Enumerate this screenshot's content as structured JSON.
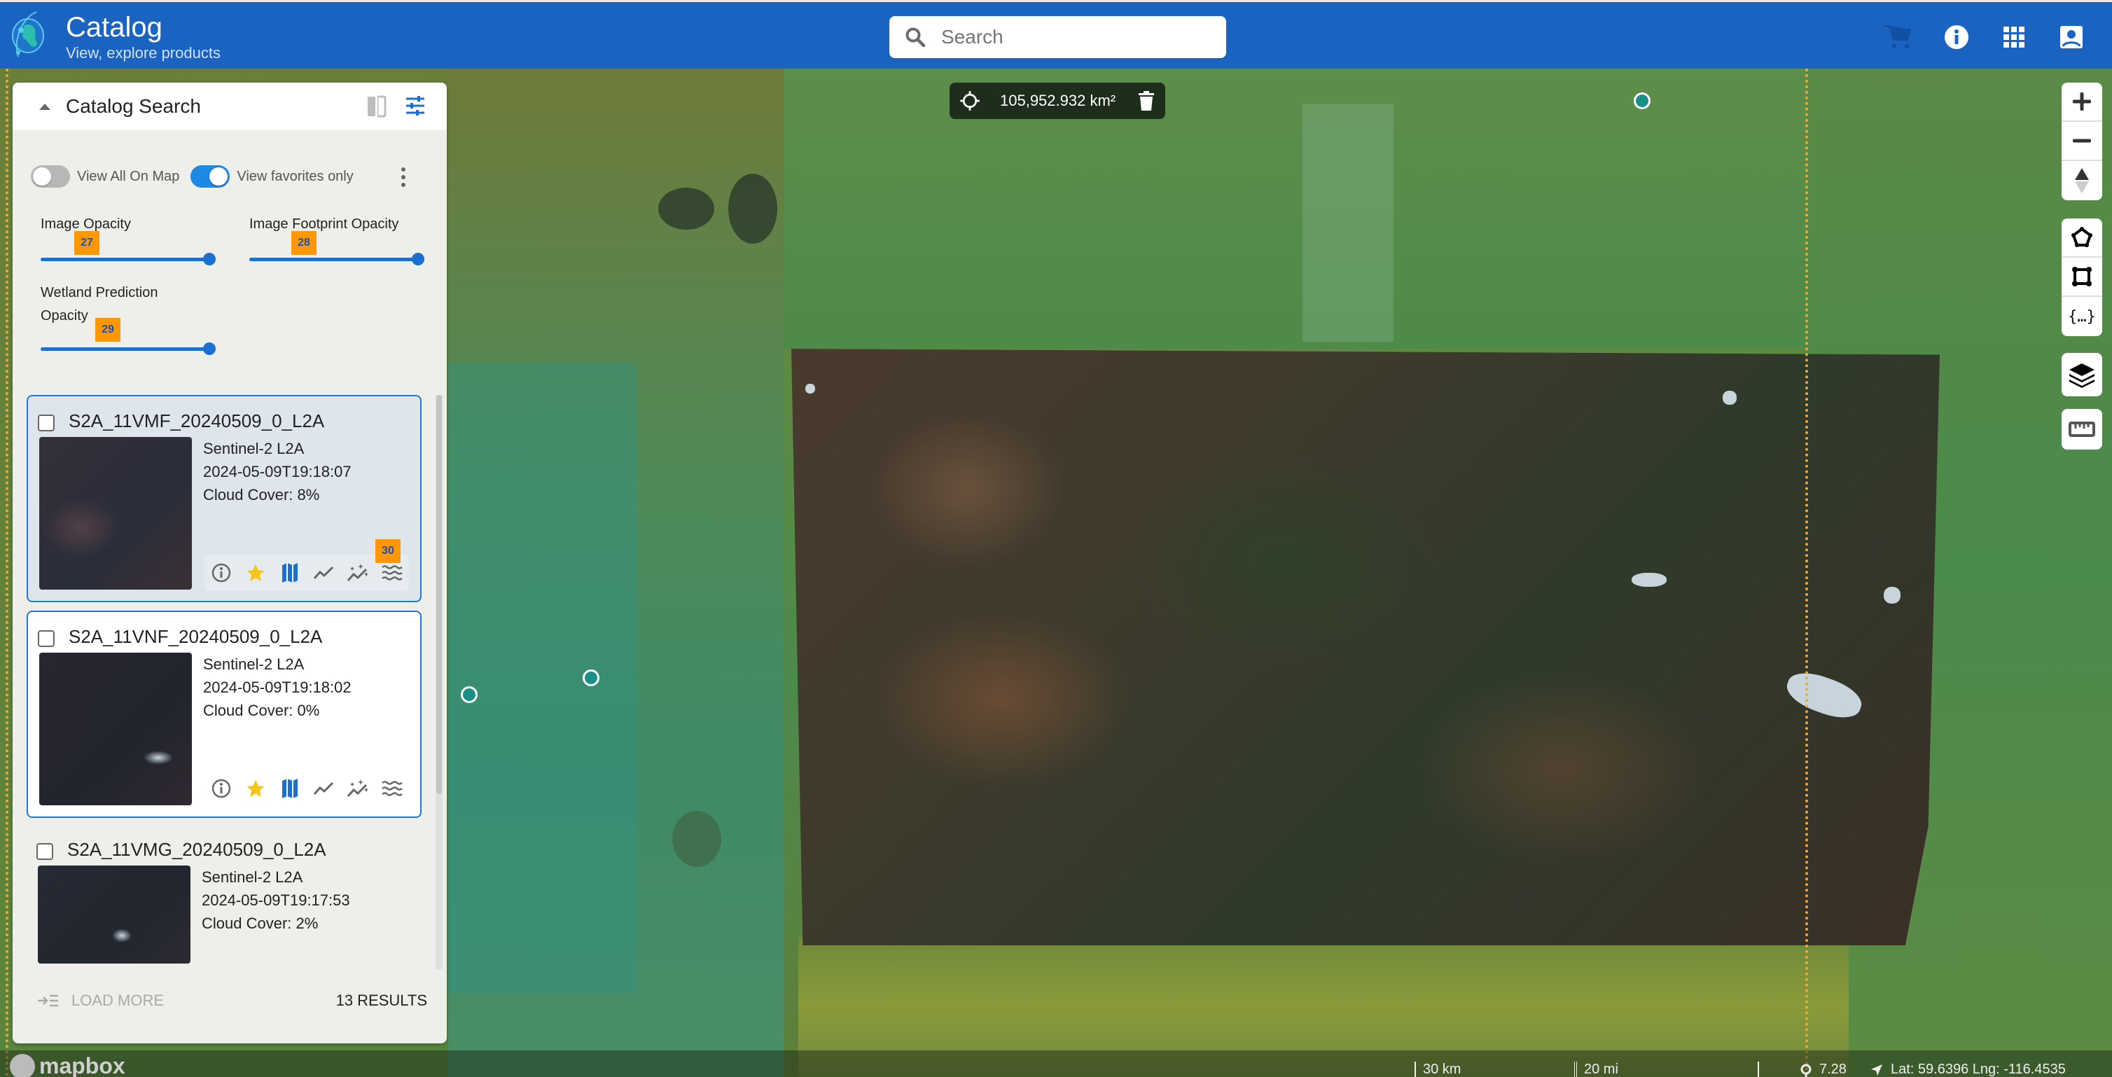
{
  "header": {
    "title": "Catalog",
    "subtitle": "View, explore products",
    "search_placeholder": "Search",
    "icons": [
      "cart-icon",
      "info-icon",
      "apps-grid-icon",
      "account-icon"
    ]
  },
  "map": {
    "area_measure": "105,952.932 km²",
    "controls": {
      "navigation": [
        "zoom-in",
        "zoom-out",
        "compass"
      ],
      "draw": [
        "polygon",
        "rectangle",
        "geojson"
      ],
      "layers": "layers",
      "measure": "ruler"
    },
    "scale_km": "30 km",
    "scale_mi": "20 mi",
    "zoom_level": "7.28",
    "coordinates": "Lat: 59.6396 Lng: -116.4535",
    "attribution": "mapbox",
    "colors": {
      "marker": "#1a9089",
      "dashed_boundary": "#f3a833"
    }
  },
  "panel": {
    "title": "Catalog Search",
    "toggles": [
      {
        "label": "View All On Map",
        "on": false
      },
      {
        "label": "View favorites only",
        "on": true
      }
    ],
    "sliders": [
      {
        "label": "Image Opacity",
        "value_percent": 100,
        "mark": "27"
      },
      {
        "label": "Image Footprint Opacity",
        "value_percent": 100,
        "mark": "28"
      },
      {
        "label_line1": "Wetland Prediction",
        "label_line2": "Opacity",
        "value_percent": 100,
        "mark": "29"
      }
    ],
    "results": [
      {
        "name": "S2A_11VMF_20240509_0_L2A",
        "collection": "Sentinel-2 L2A",
        "datetime": "2024-05-09T19:18:07",
        "cloud": "Cloud Cover: 8%",
        "selected": true,
        "favorite": true,
        "mark": "30"
      },
      {
        "name": "S2A_11VNF_20240509_0_L2A",
        "collection": "Sentinel-2 L2A",
        "datetime": "2024-05-09T19:18:02",
        "cloud": "Cloud Cover: 0%",
        "selected": false,
        "favorite": true
      },
      {
        "name": "S2A_11VMG_20240509_0_L2A",
        "collection": "Sentinel-2 L2A",
        "datetime": "2024-05-09T19:17:53",
        "cloud": "Cloud Cover: 2%",
        "selected": false
      }
    ],
    "card_actions": [
      "info-icon",
      "star-icon",
      "map-icon",
      "timeseries-icon",
      "ai-analysis-icon",
      "water-icon"
    ],
    "load_more": "LOAD MORE",
    "results_count": "13 RESULTS",
    "colors": {
      "accent": "#1a6fd1",
      "favorite": "#f5c518",
      "mark_badge": "#ff9800"
    }
  }
}
